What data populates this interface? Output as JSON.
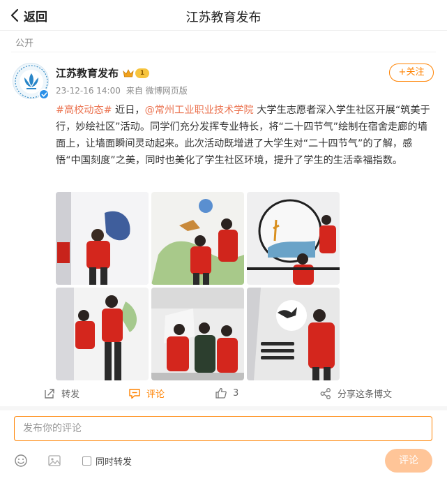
{
  "header": {
    "back_label": "返回",
    "title": "江苏教育发布"
  },
  "visibility": "公开",
  "post": {
    "author": "江苏教育发布",
    "level_badge": "1",
    "time": "23-12-16 14:00",
    "source": "来自 微博网页版",
    "follow_label": "+关注",
    "hashtag": "#高校动态#",
    "text_1": " 近日，",
    "mention": "@常州工业职业技术学院",
    "text_2": " 大学生志愿者深入学生社区开展“筑美于行，妙绘社区”活动。同学们充分发挥专业特长，将“二十四节气”绘制在宿舍走廊的墙面上，让墙面瞬间灵动起来。此次活动既增进了大学生对“二十四节气”的了解，感悟“中国刻度”之美，同时也美化了学生社区环境，提升了学生的生活幸福指数。",
    "images": [
      {
        "icon": "photo"
      },
      {
        "icon": "photo"
      },
      {
        "icon": "photo"
      },
      {
        "icon": "photo"
      },
      {
        "icon": "photo"
      },
      {
        "icon": "photo"
      }
    ]
  },
  "actions": {
    "repost_label": "转发",
    "comment_label": "评论",
    "like_count": "3",
    "share_label": "分享这条博文"
  },
  "composer": {
    "placeholder": "发布你的评论",
    "also_repost_label": "同时转发",
    "submit_label": "评论"
  },
  "colors": {
    "accent": "#ff8200",
    "link": "#eb7350",
    "verified": "#2b90e8",
    "submit_disabled": "#ffc598"
  }
}
